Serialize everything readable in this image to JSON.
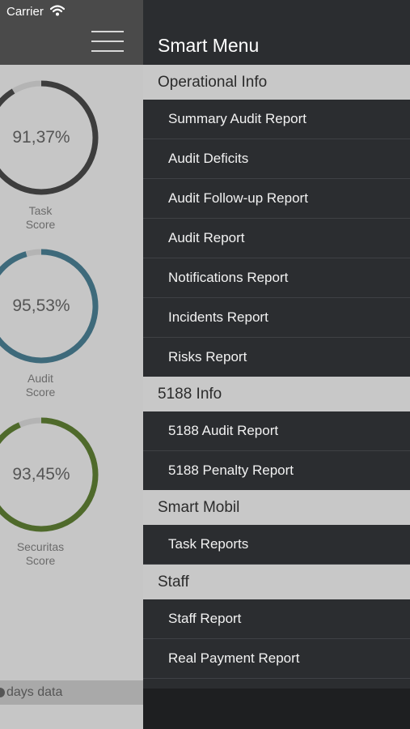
{
  "status_bar": {
    "carrier": "Carrier"
  },
  "icons": {
    "wifi": "wifi-icon",
    "menu": "hamburger-menu-icon"
  },
  "colors": {
    "task_gauge": "#3d3d3d",
    "audit_gauge": "#3e6a7b",
    "securitas_gauge": "#4f6a2b",
    "gauge_track": "#b4b4b4",
    "menu_bg": "#2b2d30",
    "section_bg": "#c8c8c8"
  },
  "dashboard": {
    "gauges": [
      {
        "value": "91,37%",
        "percent": 91.37,
        "label_line1": "Task",
        "label_line2": "Score"
      },
      {
        "value": "95,53%",
        "percent": 95.53,
        "label_line1": "Audit",
        "label_line2": "Score"
      },
      {
        "value": "93,45%",
        "percent": 93.45,
        "label_line1": "Securitas",
        "label_line2": "Score"
      }
    ],
    "days_text": "days data"
  },
  "menu": {
    "title": "Smart Menu",
    "sections": [
      {
        "title": "Operational Info",
        "items": [
          "Summary Audit Report",
          "Audit Deficits",
          "Audit Follow-up Report",
          "Audit Report",
          "Notifications Report",
          "Incidents Report",
          "Risks Report"
        ]
      },
      {
        "title": "5188 Info",
        "items": [
          "5188 Audit Report",
          "5188 Penalty Report"
        ]
      },
      {
        "title": "Smart Mobil",
        "items": [
          "Task Reports"
        ]
      },
      {
        "title": "Staff",
        "items": [
          "Staff Report",
          "Real Payment Report"
        ]
      }
    ]
  }
}
